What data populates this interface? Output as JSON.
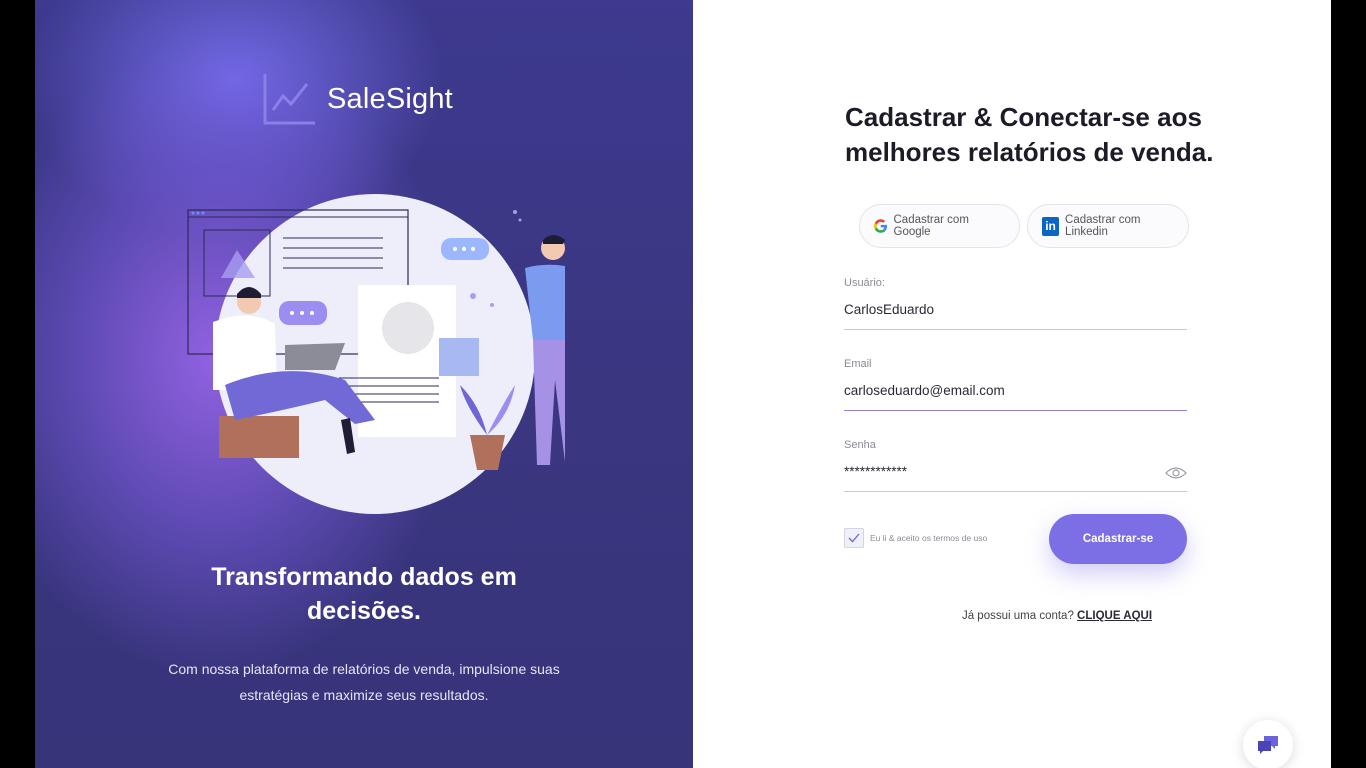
{
  "brand": {
    "name": "SaleSight",
    "accent": "#7c6fe6"
  },
  "left_panel": {
    "tagline": "Transformando dados em decisões.",
    "subtitle": "Com nossa plataforma de relatórios de venda, impulsione suas estratégias e maximize seus resultados."
  },
  "form": {
    "heading": "Cadastrar & Conectar-se aos melhores relatórios de venda.",
    "google_label": "Cadastrar com Google",
    "linkedin_label": "Cadastrar com Linkedin",
    "username": {
      "label": "Usuário:",
      "value": "CarlosEduardo"
    },
    "email": {
      "label": "Email",
      "value": "carloseduardo@email.com"
    },
    "password": {
      "label": "Senha",
      "value": "************"
    },
    "terms_label": "Eu li & aceito os termos de uso",
    "terms_checked": true,
    "submit_label": "Cadastrar-se",
    "login_prompt": "Já possui uma conta?",
    "login_link": "CLIQUE AQUI"
  },
  "icons": {
    "logo": "line-chart-logo-icon",
    "google": "google-icon",
    "linkedin": "linkedin-icon",
    "eye": "eye-icon",
    "check": "check-icon",
    "chat": "chat-bubbles-icon"
  }
}
